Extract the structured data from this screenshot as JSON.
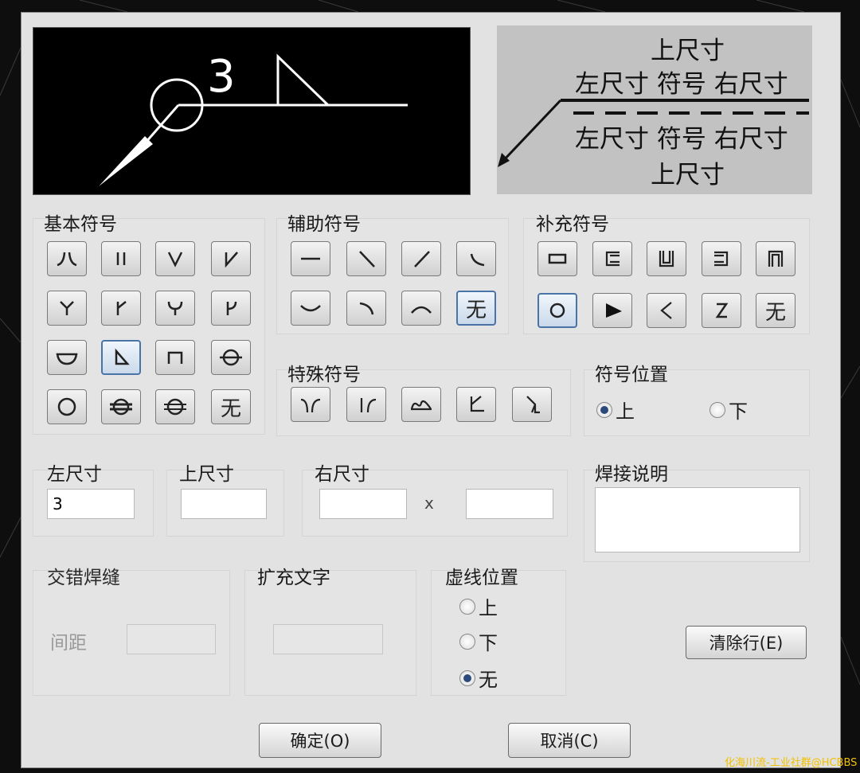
{
  "preview": {
    "size_number": "3",
    "lines": [
      "上尺寸",
      "左尺寸 符号 右尺寸",
      "左尺寸 符号 右尺寸",
      "上尺寸"
    ]
  },
  "groups": {
    "basic": "基本符号",
    "aux": "辅助符号",
    "supp": "补充符号",
    "special": "特殊符号",
    "symbol_pos": "符号位置",
    "left_dim": "左尺寸",
    "top_dim": "上尺寸",
    "right_dim": "右尺寸",
    "weld_note": "焊接说明",
    "stagger": "交错焊缝",
    "ext_text": "扩充文字",
    "dash_pos": "虚线位置"
  },
  "symbol_none": "无",
  "symbol_pos_options": [
    "上",
    "下"
  ],
  "symbol_pos_selected": "上",
  "dash_pos_options": [
    "上",
    "下",
    "无"
  ],
  "dash_pos_selected": "无",
  "fields": {
    "left_dim_value": "3",
    "top_dim_value": "",
    "right_dim_value_1": "",
    "right_dim_sep": "x",
    "right_dim_value_2": "",
    "weld_note_value": "",
    "spacing_label": "间距",
    "spacing_value": "",
    "ext_text_value": ""
  },
  "buttons": {
    "clear_row": "清除行(E)",
    "ok": "确定(O)",
    "cancel": "取消(C)"
  },
  "watermark": "化海川流-工业社群@HCBBS"
}
